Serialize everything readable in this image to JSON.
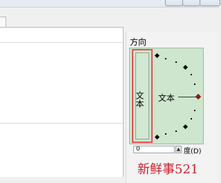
{
  "group": {
    "title": "方向"
  },
  "orientation": {
    "vertical_text": "文本",
    "horizontal_text": "文本"
  },
  "degree": {
    "value": "0",
    "spin_glyph": "▲",
    "label": "度(D)"
  },
  "watermark": {
    "text": "新鲜事521"
  },
  "colors": {
    "selected_border": "#e05353",
    "dial_background": "#cde6cd",
    "handle_active": "#8b1a1a",
    "watermark": "#cc1f2d"
  }
}
